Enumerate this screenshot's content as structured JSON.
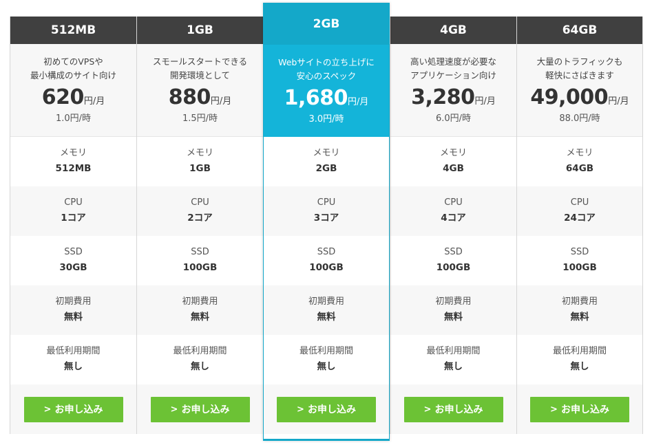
{
  "colors": {
    "header": "#404040",
    "featured": "#14b4d9",
    "button": "#6cc235"
  },
  "spec_labels": {
    "memory": "メモリ",
    "cpu": "CPU",
    "ssd": "SSD",
    "initial": "初期費用",
    "min_period": "最低利用期間"
  },
  "plans": [
    {
      "name": "512MB",
      "desc1": "初めてのVPSや",
      "desc2": "最小構成のサイト向け",
      "price": "620",
      "unit": "円/月",
      "hourly": "1.0円/時",
      "memory": "512MB",
      "cpu": "1コア",
      "ssd": "30GB",
      "initial": "無料",
      "min_period": "無し",
      "button": "お申し込み",
      "button_icon": "chevron-right-icon"
    },
    {
      "name": "1GB",
      "desc1": "スモールスタートできる",
      "desc2": "開発環境として",
      "price": "880",
      "unit": "円/月",
      "hourly": "1.5円/時",
      "memory": "1GB",
      "cpu": "2コア",
      "ssd": "100GB",
      "initial": "無料",
      "min_period": "無し",
      "button": "お申し込み",
      "button_icon": "chevron-right-icon"
    },
    {
      "name": "2GB",
      "desc1": "Webサイトの立ち上げに",
      "desc2": "安心のスペック",
      "price": "1,680",
      "unit": "円/月",
      "hourly": "3.0円/時",
      "memory": "2GB",
      "cpu": "3コア",
      "ssd": "100GB",
      "initial": "無料",
      "min_period": "無し",
      "button": "お申し込み",
      "button_icon": "chevron-right-icon"
    },
    {
      "name": "4GB",
      "desc1": "高い処理速度が必要な",
      "desc2": "アプリケーション向け",
      "price": "3,280",
      "unit": "円/月",
      "hourly": "6.0円/時",
      "memory": "4GB",
      "cpu": "4コア",
      "ssd": "100GB",
      "initial": "無料",
      "min_period": "無し",
      "button": "お申し込み",
      "button_icon": "chevron-right-icon"
    },
    {
      "name": "64GB",
      "desc1": "大量のトラフィックも",
      "desc2": "軽快にさばきます",
      "price": "49,000",
      "unit": "円/月",
      "hourly": "88.0円/時",
      "memory": "64GB",
      "cpu": "24コア",
      "ssd": "100GB",
      "initial": "無料",
      "min_period": "無し",
      "button": "お申し込み",
      "button_icon": "chevron-right-icon"
    }
  ]
}
